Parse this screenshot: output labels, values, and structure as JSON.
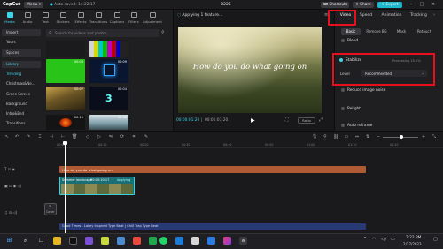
{
  "titlebar": {
    "logo": "CapCut",
    "menu_label": "Menu",
    "autosave": "Auto saved: 14:22:17",
    "project_title": "0225",
    "shortcuts_label": "Shortcuts",
    "share_label": "Share",
    "export_label": "Export"
  },
  "media_tabs": [
    {
      "label": "Media"
    },
    {
      "label": "Audio"
    },
    {
      "label": "Text"
    },
    {
      "label": "Stickers"
    },
    {
      "label": "Effects"
    },
    {
      "label": "Transitions"
    },
    {
      "label": "Captions"
    },
    {
      "label": "Filters"
    },
    {
      "label": "Adjustment"
    }
  ],
  "sidebar": {
    "items": [
      {
        "label": "Import"
      },
      {
        "label": "Yours"
      },
      {
        "label": "Spaces"
      },
      {
        "label": "Library"
      },
      {
        "label": "Trending"
      },
      {
        "label": "Christmas&Ne..."
      },
      {
        "label": "Green Screen"
      },
      {
        "label": "Background"
      },
      {
        "label": "Intro&End"
      },
      {
        "label": "Transitions"
      }
    ]
  },
  "search": {
    "placeholder": "Search for videos and photos"
  },
  "thumbnails": {
    "durations": [
      "00:06",
      "00:09",
      "00:07",
      "00:04",
      "00:10",
      "00:08"
    ]
  },
  "player": {
    "header": "Applying 1 feature...",
    "video_text": "How do you do what going on",
    "current_time": "00:00:01:20",
    "total_time": "00:01:07:20",
    "ratio_label": "Ratio"
  },
  "right_panel": {
    "tabs": [
      {
        "label": "Video"
      },
      {
        "label": "Speed"
      },
      {
        "label": "Animation"
      },
      {
        "label": "Tracking"
      }
    ],
    "subtabs": [
      {
        "label": "Basic"
      },
      {
        "label": "Remove BG"
      },
      {
        "label": "Mask"
      },
      {
        "label": "Retouch"
      }
    ],
    "blend_label": "Blend",
    "stabilize_label": "Stabilize",
    "stabilize_status": "Processing 15.0%",
    "level_label": "Level",
    "level_value": "Recommended",
    "reduce_noise_label": "Reduce image noise",
    "relight_label": "Relight",
    "auto_reframe_label": "Auto reframe"
  },
  "timeline": {
    "ticks": [
      "00:00",
      "00:10",
      "00:20",
      "00:30",
      "00:40",
      "00:50",
      "01:00",
      "01:10",
      "01:20"
    ],
    "text_clip": "How do you do what going on",
    "video_clip_title": "Summer landscape",
    "video_clip_duration": "00:00:10:17",
    "video_clip_status": "Applying",
    "cover_label": "Cover",
    "audio_clip": "Good Times - Lakey Inspired Type Beat | Chill Trap Type Beat"
  },
  "taskbar": {
    "time": "2:22 PM",
    "date": "2/27/2023"
  }
}
